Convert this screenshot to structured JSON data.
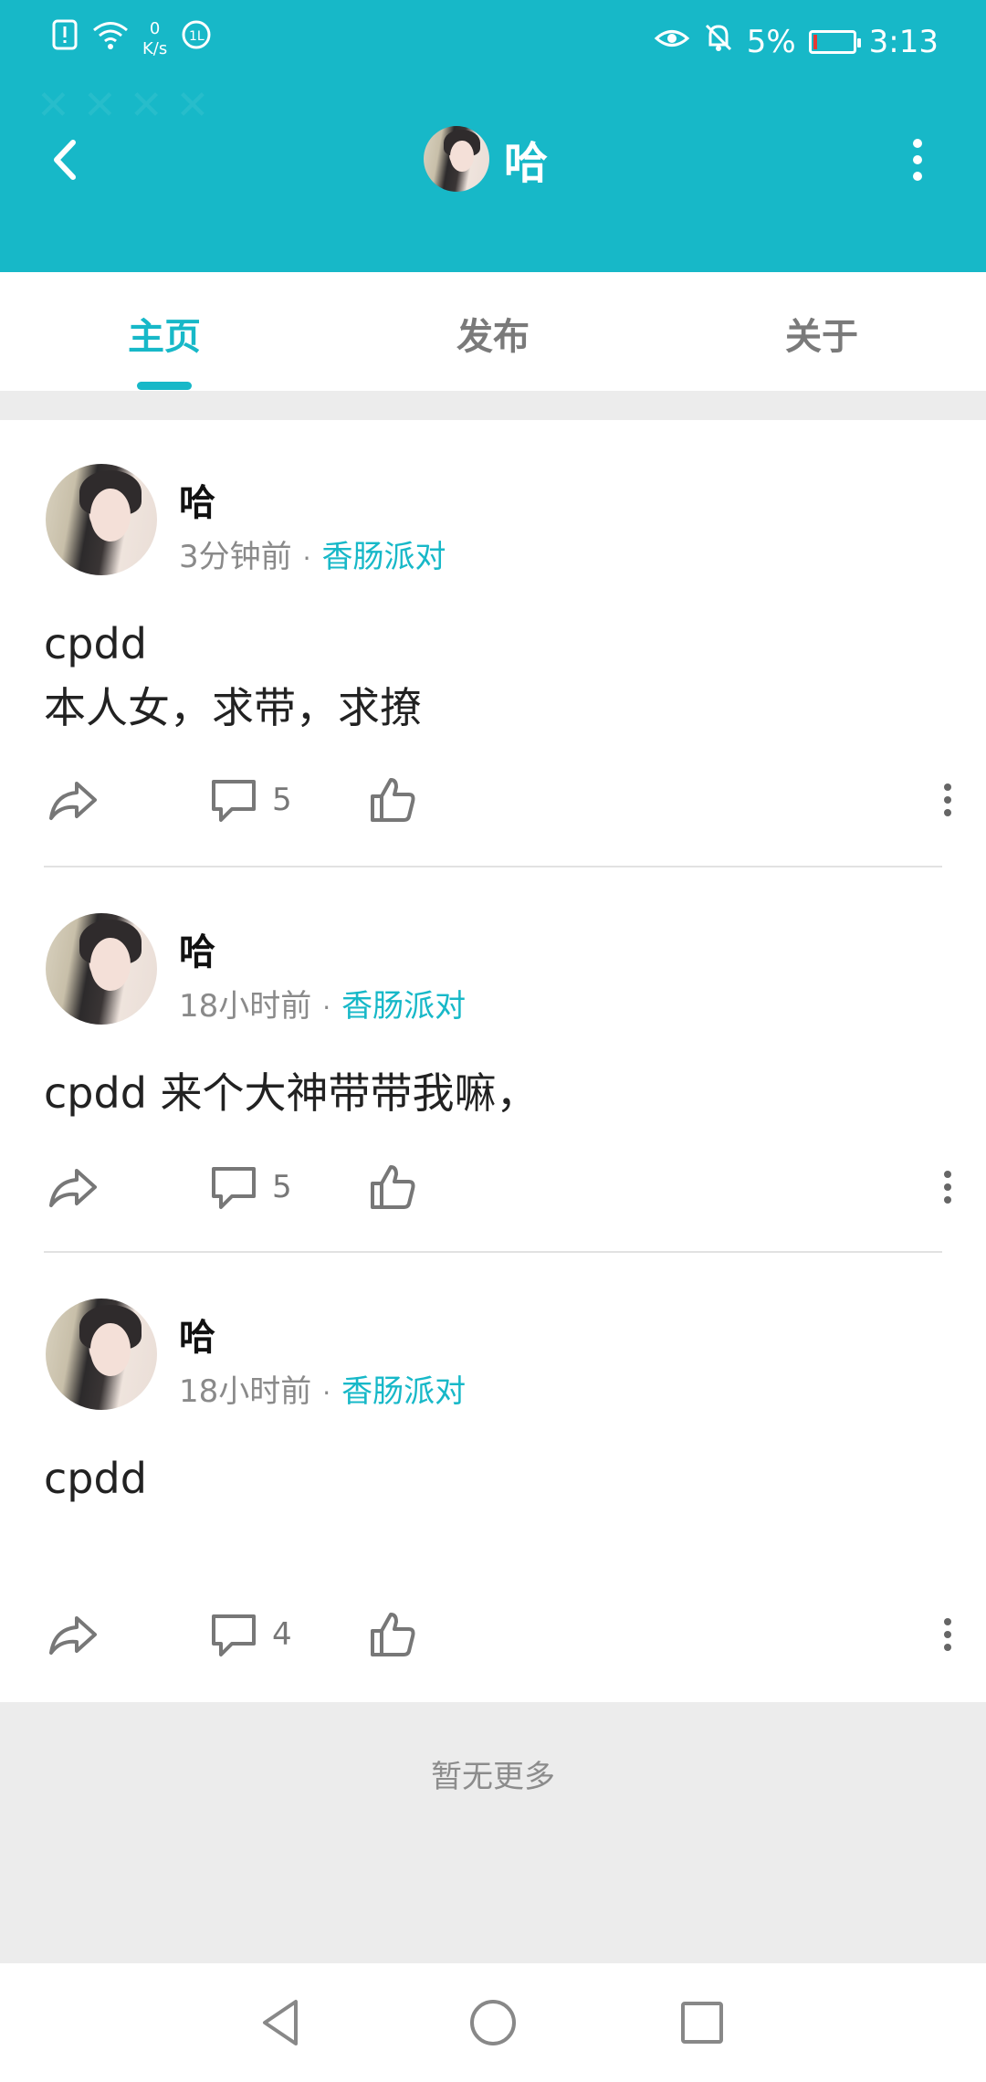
{
  "status_bar": {
    "net_speed_value": "0",
    "net_speed_unit": "K/s",
    "battery_percent": "5%",
    "time": "3:13"
  },
  "nav": {
    "title": "哈"
  },
  "tabs": [
    {
      "label": "主页",
      "active": true
    },
    {
      "label": "发布",
      "active": false
    },
    {
      "label": "关于",
      "active": false
    }
  ],
  "posts": [
    {
      "author": "哈",
      "time": "3分钟前",
      "separator": "·",
      "topic": "香肠派对",
      "content_line1": "cpdd",
      "content_line2": "本人女，求带，求撩",
      "comments": "5"
    },
    {
      "author": "哈",
      "time": "18小时前",
      "separator": "·",
      "topic": "香肠派对",
      "content_line1": "cpdd 来个大神带带我嘛，",
      "content_line2": "",
      "comments": "5"
    },
    {
      "author": "哈",
      "time": "18小时前",
      "separator": "·",
      "topic": "香肠派对",
      "content_line1": "cpdd",
      "content_line2": "",
      "comments": "4"
    }
  ],
  "footer": {
    "no_more": "暂无更多"
  },
  "colors": {
    "accent": "#17b8c8",
    "battery_low": "#e53935"
  },
  "icons": [
    "back-arrow-icon",
    "more-vertical-icon",
    "share-icon",
    "comment-icon",
    "thumbs-up-icon",
    "nav-back-triangle-icon",
    "nav-home-circle-icon",
    "nav-recents-square-icon"
  ]
}
